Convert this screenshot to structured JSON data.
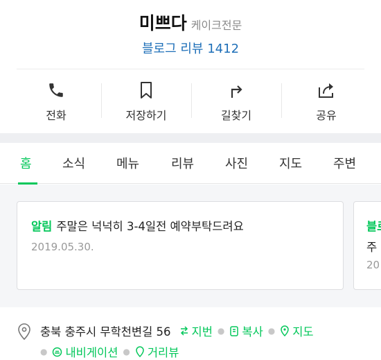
{
  "header": {
    "place_name": "미쁘다",
    "category": "케이크전문",
    "blog_review_label": "블로그 리뷰",
    "blog_review_count": "1412"
  },
  "actions": [
    {
      "label": "전화",
      "icon": "phone-icon"
    },
    {
      "label": "저장하기",
      "icon": "bookmark-icon"
    },
    {
      "label": "길찾기",
      "icon": "directions-icon"
    },
    {
      "label": "공유",
      "icon": "share-icon"
    }
  ],
  "tabs": [
    {
      "label": "홈",
      "active": true
    },
    {
      "label": "소식"
    },
    {
      "label": "메뉴"
    },
    {
      "label": "리뷰"
    },
    {
      "label": "사진"
    },
    {
      "label": "지도"
    },
    {
      "label": "주변"
    }
  ],
  "notice_card": {
    "tag": "알림",
    "text": "주말은 넉넉히 3-4일전 예약부탁드려요",
    "date": "2019.05.30."
  },
  "peek_card": {
    "tag": "블로",
    "line2": "주",
    "line3": "20"
  },
  "address": {
    "text": "충북 충주시 무학천변길 56",
    "lot_number_label": "지번",
    "copy_label": "복사",
    "map_label": "지도",
    "navigation_label": "내비게이션",
    "street_view_label": "거리뷰"
  },
  "colors": {
    "accent": "#03c75a",
    "link_blue": "#1e6fb8",
    "background_gray": "#f5f6f8"
  }
}
